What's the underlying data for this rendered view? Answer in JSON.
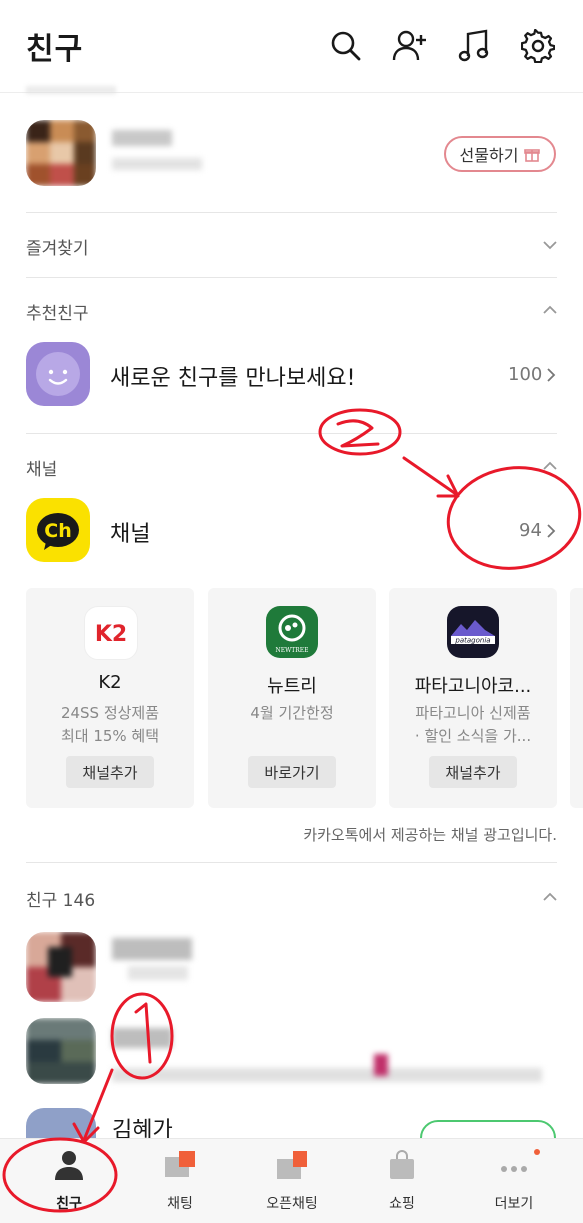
{
  "header": {
    "title": "친구",
    "icons": [
      "search-icon",
      "add-friend-icon",
      "music-icon",
      "settings-icon"
    ]
  },
  "birthday_section": {
    "gift_button_label": "선물하기"
  },
  "favorites": {
    "label": "즐겨찾기"
  },
  "recommended": {
    "label": "추천친구",
    "row_label": "새로운 친구를 만나보세요!",
    "count": "100"
  },
  "channel": {
    "label": "채널",
    "row_label": "채널",
    "count": "94",
    "cards": [
      {
        "name": "K2",
        "desc1": "24SS 정상제품",
        "desc2": "최대 15% 혜택",
        "button": "채널추가",
        "logo_text": "K2"
      },
      {
        "name": "뉴트리",
        "desc1": "4월 기간한정",
        "desc2": "",
        "button": "바로가기",
        "logo_text": "NEWTREE"
      },
      {
        "name": "파타고니아코...",
        "desc1": "파타고니아 신제품",
        "desc2": "· 할인 소식을 가...",
        "button": "채널추가",
        "logo_text": "patagonia"
      }
    ],
    "ad_notice": "카카오톡에서 제공하는 채널 광고입니다."
  },
  "friends": {
    "label": "친구 146",
    "partial_name": "김혜가"
  },
  "annotations": {
    "one": "1",
    "two": "2"
  },
  "tabbar": {
    "tabs": [
      {
        "label": "친구",
        "icon": "person-icon"
      },
      {
        "label": "채팅",
        "icon": "chat-icon"
      },
      {
        "label": "오픈채팅",
        "icon": "open-chat-icon"
      },
      {
        "label": "쇼핑",
        "icon": "shopping-bag-icon"
      },
      {
        "label": "더보기",
        "icon": "more-icon"
      }
    ]
  },
  "colors": {
    "accent_red": "#e8192a",
    "kakao_yellow": "#fae100",
    "recommend_purple": "#9b87d6",
    "gift_border": "#e3888f",
    "badge_orange": "#f0603a"
  }
}
